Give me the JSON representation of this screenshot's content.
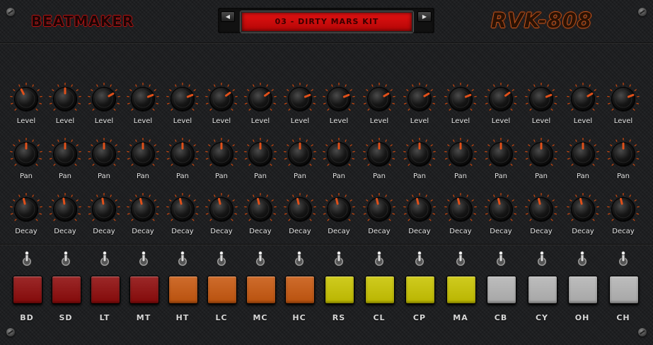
{
  "header": {
    "brand": "BEATMAKER",
    "model": "RVK-808",
    "preset": "03 - DIRTY MARS KIT",
    "prev_symbol": "◀",
    "next_symbol": "▶"
  },
  "knob_rows": [
    {
      "label": "Level",
      "values": [
        0.4,
        0.5,
        0.72,
        0.75,
        0.75,
        0.7,
        0.7,
        0.75,
        0.75,
        0.72,
        0.72,
        0.75,
        0.7,
        0.75,
        0.72,
        0.75
      ]
    },
    {
      "label": "Pan",
      "values": [
        0.5,
        0.5,
        0.5,
        0.5,
        0.5,
        0.5,
        0.5,
        0.5,
        0.5,
        0.5,
        0.5,
        0.5,
        0.5,
        0.5,
        0.5,
        0.5
      ]
    },
    {
      "label": "Decay",
      "values": [
        0.45,
        0.47,
        0.47,
        0.45,
        0.45,
        0.45,
        0.45,
        0.45,
        0.45,
        0.45,
        0.45,
        0.45,
        0.45,
        0.45,
        0.45,
        0.45
      ]
    }
  ],
  "channels": [
    {
      "name": "BD",
      "color": "#8e0b0b"
    },
    {
      "name": "SD",
      "color": "#8e0b0b"
    },
    {
      "name": "LT",
      "color": "#8e0b0b"
    },
    {
      "name": "MT",
      "color": "#8e0b0b"
    },
    {
      "name": "HT",
      "color": "#c8580f"
    },
    {
      "name": "LC",
      "color": "#c8580f"
    },
    {
      "name": "MC",
      "color": "#c8580f"
    },
    {
      "name": "HC",
      "color": "#c8580f"
    },
    {
      "name": "RS",
      "color": "#c9c400"
    },
    {
      "name": "CL",
      "color": "#c9c400"
    },
    {
      "name": "CP",
      "color": "#c9c400"
    },
    {
      "name": "MA",
      "color": "#c9c400"
    },
    {
      "name": "CB",
      "color": "#b4b4b4"
    },
    {
      "name": "CY",
      "color": "#b4b4b4"
    },
    {
      "name": "OH",
      "color": "#b4b4b4"
    },
    {
      "name": "CH",
      "color": "#b4b4b4"
    }
  ],
  "colors": {
    "knob_indicator": "#e0501a",
    "tick": "#c4460f"
  }
}
